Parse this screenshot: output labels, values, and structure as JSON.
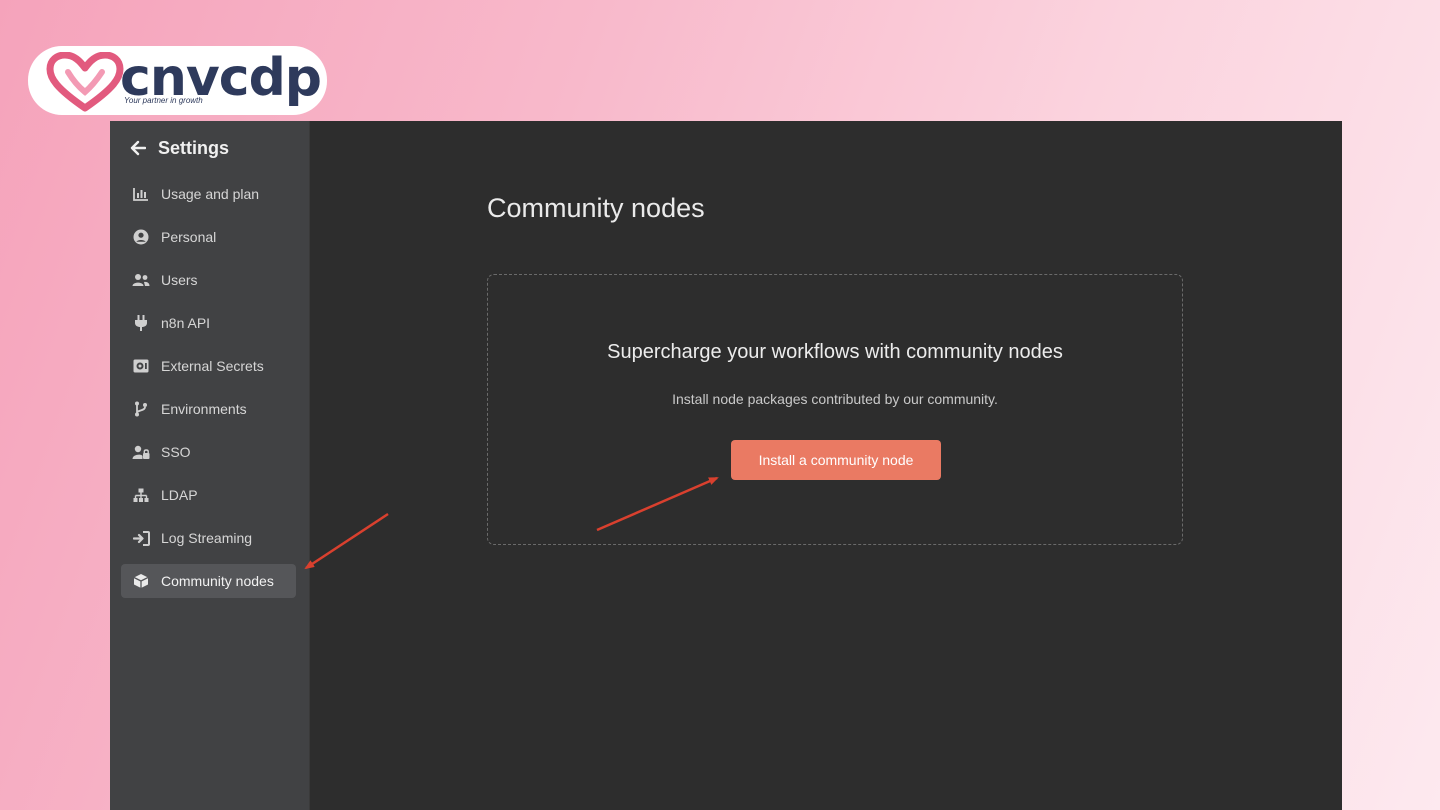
{
  "logo": {
    "brand": "cnvcdp",
    "tagline": "Your partner in growth",
    "colors": {
      "heart": "#e25a7e",
      "text": "#2e3a5c"
    }
  },
  "sidebar": {
    "header": "Settings",
    "items": [
      {
        "label": "Usage and plan",
        "icon": "bar-chart-icon"
      },
      {
        "label": "Personal",
        "icon": "user-circle-icon"
      },
      {
        "label": "Users",
        "icon": "users-icon"
      },
      {
        "label": "n8n API",
        "icon": "plug-icon"
      },
      {
        "label": "External Secrets",
        "icon": "vault-icon"
      },
      {
        "label": "Environments",
        "icon": "git-branch-icon"
      },
      {
        "label": "SSO",
        "icon": "user-lock-icon"
      },
      {
        "label": "LDAP",
        "icon": "network-icon"
      },
      {
        "label": "Log Streaming",
        "icon": "sign-in-icon"
      },
      {
        "label": "Community nodes",
        "icon": "cube-icon",
        "active": true
      }
    ]
  },
  "main": {
    "title": "Community nodes",
    "empty_state": {
      "heading": "Supercharge your workflows with community nodes",
      "description": "Install node packages contributed by our community.",
      "button_label": "Install a community node"
    }
  },
  "colors": {
    "accent": "#ea7a63",
    "annotation_arrow": "#d9402e",
    "sidebar_bg": "#414244",
    "main_bg": "#2d2d2d"
  }
}
